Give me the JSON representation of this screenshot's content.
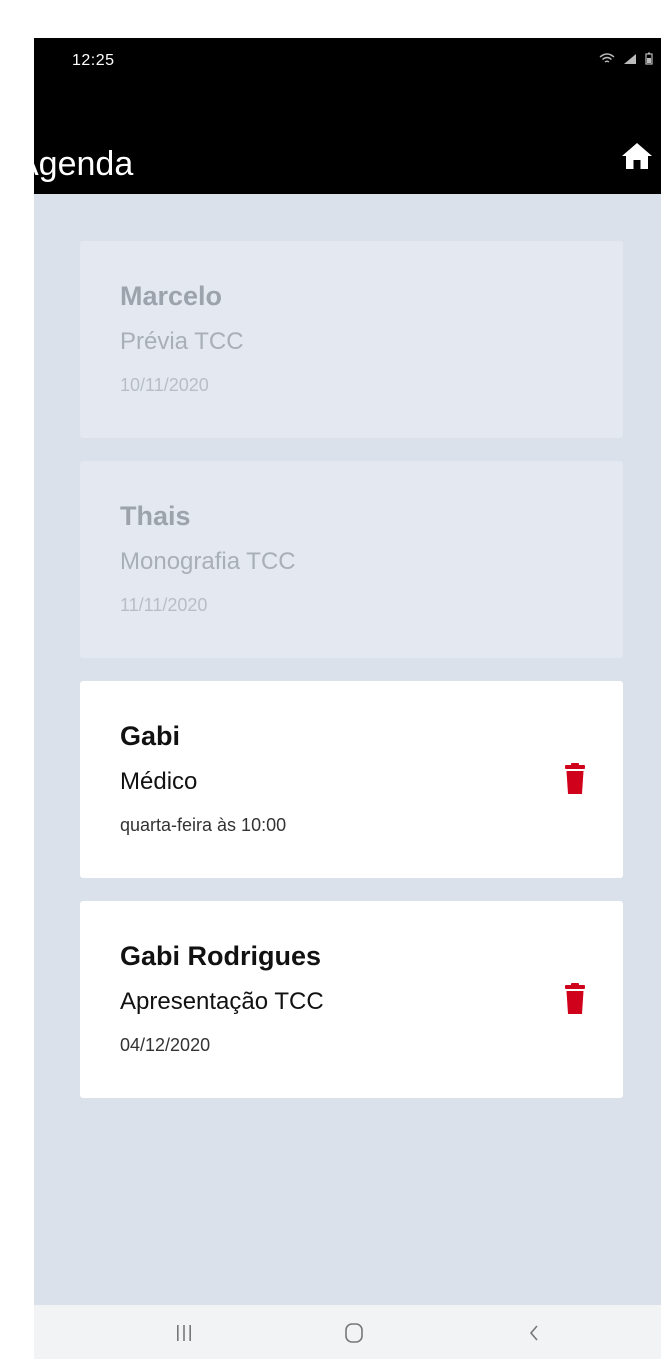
{
  "status_bar": {
    "time": "12:25"
  },
  "app_bar": {
    "title": "Agenda",
    "home_icon": "home-icon"
  },
  "appointments": [
    {
      "name": "Marcelo",
      "description": "Prévia TCC",
      "date": "10/11/2020",
      "state": "past"
    },
    {
      "name": "Thais",
      "description": "Monografia TCC",
      "date": "11/11/2020",
      "state": "past"
    },
    {
      "name": "Gabi",
      "description": "Médico",
      "date": "quarta-feira às 10:00",
      "state": "active",
      "action_icon": "trash-icon"
    },
    {
      "name": "Gabi Rodrigues",
      "description": "Apresentação TCC",
      "date": "04/12/2020",
      "state": "active",
      "action_icon": "trash-icon"
    }
  ],
  "nav_bar": {
    "recents_icon": "recents-icon",
    "home_icon": "home-circle-icon",
    "back_icon": "back-icon"
  },
  "colors": {
    "background": "#dbe1ea",
    "app_bar": "#000000",
    "card_active": "#ffffff",
    "card_past": "#e4e9f1",
    "delete": "#d0021b"
  }
}
